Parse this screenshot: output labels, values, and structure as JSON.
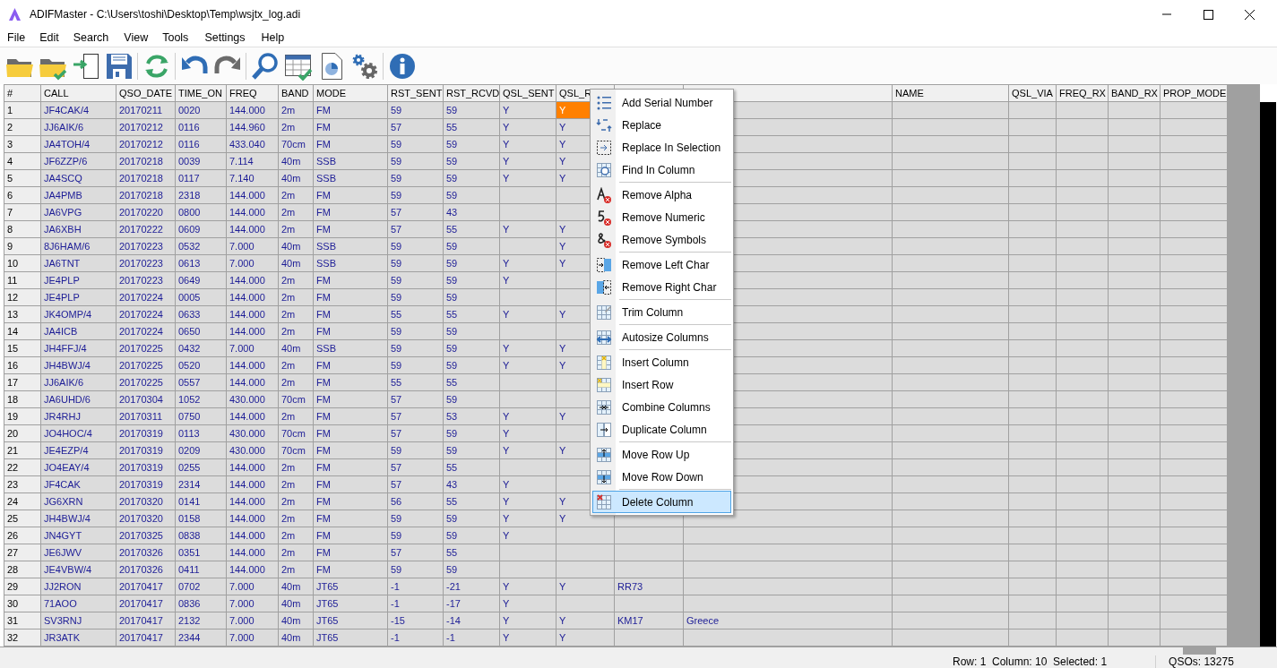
{
  "window": {
    "title": "ADIFMaster - C:\\Users\\toshi\\Desktop\\Temp\\wsjtx_log.adi"
  },
  "menu_bar": [
    "File",
    "Edit",
    "Search",
    "View",
    "Tools",
    "Settings",
    "Help"
  ],
  "table": {
    "columns": [
      {
        "label": "#",
        "selected": false
      },
      {
        "label": "CALL",
        "selected": false
      },
      {
        "label": "QSO_DATE",
        "selected": false
      },
      {
        "label": "TIME_ON",
        "selected": false
      },
      {
        "label": "FREQ",
        "selected": false
      },
      {
        "label": "BAND",
        "selected": false
      },
      {
        "label": "MODE",
        "selected": false
      },
      {
        "label": "RST_SENT",
        "selected": false
      },
      {
        "label": "RST_RCVD",
        "selected": false
      },
      {
        "label": "QSL_SENT",
        "selected": false
      },
      {
        "label": "QSL_R",
        "selected": true
      },
      {},
      {},
      {
        "label": "NAME",
        "selected": false
      },
      {
        "label": "QSL_VIA",
        "selected": false
      },
      {
        "label": "FREQ_RX",
        "selected": false
      },
      {
        "label": "BAND_RX",
        "selected": false
      },
      {
        "label": "PROP_MODE",
        "selected": false
      }
    ],
    "rows": [
      {
        "selected": true,
        "cells": [
          "1",
          "JF4CAK/4",
          "20170211",
          "0020",
          "144.000",
          "2m",
          "FM",
          "59",
          "59",
          "Y",
          "Y"
        ]
      },
      {
        "selected": false,
        "cells": [
          "2",
          "JJ6AIK/6",
          "20170212",
          "0116",
          "144.960",
          "2m",
          "FM",
          "57",
          "55",
          "Y",
          "Y"
        ]
      },
      {
        "selected": false,
        "cells": [
          "3",
          "JA4TOH/4",
          "20170212",
          "0116",
          "433.040",
          "70cm",
          "FM",
          "59",
          "59",
          "Y",
          "Y"
        ]
      },
      {
        "selected": false,
        "cells": [
          "4",
          "JF6ZZP/6",
          "20170218",
          "0039",
          "7.114",
          "40m",
          "SSB",
          "59",
          "59",
          "Y",
          "Y"
        ]
      },
      {
        "selected": false,
        "cells": [
          "5",
          "JA4SCQ",
          "20170218",
          "0117",
          "7.140",
          "40m",
          "SSB",
          "59",
          "59",
          "Y",
          "Y"
        ]
      },
      {
        "selected": false,
        "cells": [
          "6",
          "JA4PMB",
          "20170218",
          "2318",
          "144.000",
          "2m",
          "FM",
          "59",
          "59"
        ]
      },
      {
        "selected": false,
        "cells": [
          "7",
          "JA6VPG",
          "20170220",
          "0800",
          "144.000",
          "2m",
          "FM",
          "57",
          "43"
        ]
      },
      {
        "selected": false,
        "cells": [
          "8",
          "JA6XBH",
          "20170222",
          "0609",
          "144.000",
          "2m",
          "FM",
          "57",
          "55",
          "Y",
          "Y"
        ]
      },
      {
        "selected": false,
        "cells": [
          "9",
          "8J6HAM/6",
          "20170223",
          "0532",
          "7.000",
          "40m",
          "SSB",
          "59",
          "59",
          "",
          "Y"
        ]
      },
      {
        "selected": false,
        "cells": [
          "10",
          "JA6TNT",
          "20170223",
          "0613",
          "7.000",
          "40m",
          "SSB",
          "59",
          "59",
          "Y",
          "Y"
        ]
      },
      {
        "selected": false,
        "cells": [
          "11",
          "JE4PLP",
          "20170223",
          "0649",
          "144.000",
          "2m",
          "FM",
          "59",
          "59",
          "Y"
        ]
      },
      {
        "selected": false,
        "cells": [
          "12",
          "JE4PLP",
          "20170224",
          "0005",
          "144.000",
          "2m",
          "FM",
          "59",
          "59"
        ]
      },
      {
        "selected": false,
        "cells": [
          "13",
          "JK4OMP/4",
          "20170224",
          "0633",
          "144.000",
          "2m",
          "FM",
          "55",
          "55",
          "Y",
          "Y"
        ]
      },
      {
        "selected": false,
        "cells": [
          "14",
          "JA4ICB",
          "20170224",
          "0650",
          "144.000",
          "2m",
          "FM",
          "59",
          "59"
        ]
      },
      {
        "selected": false,
        "cells": [
          "15",
          "JH4FFJ/4",
          "20170225",
          "0432",
          "7.000",
          "40m",
          "SSB",
          "59",
          "59",
          "Y",
          "Y"
        ]
      },
      {
        "selected": false,
        "cells": [
          "16",
          "JH4BWJ/4",
          "20170225",
          "0520",
          "144.000",
          "2m",
          "FM",
          "59",
          "59",
          "Y",
          "Y"
        ]
      },
      {
        "selected": false,
        "cells": [
          "17",
          "JJ6AIK/6",
          "20170225",
          "0557",
          "144.000",
          "2m",
          "FM",
          "55",
          "55"
        ]
      },
      {
        "selected": false,
        "cells": [
          "18",
          "JA6UHD/6",
          "20170304",
          "1052",
          "430.000",
          "70cm",
          "FM",
          "57",
          "59"
        ]
      },
      {
        "selected": false,
        "cells": [
          "19",
          "JR4RHJ",
          "20170311",
          "0750",
          "144.000",
          "2m",
          "FM",
          "57",
          "53",
          "Y",
          "Y"
        ]
      },
      {
        "selected": false,
        "cells": [
          "20",
          "JO4HOC/4",
          "20170319",
          "0113",
          "430.000",
          "70cm",
          "FM",
          "57",
          "59",
          "Y"
        ]
      },
      {
        "selected": false,
        "cells": [
          "21",
          "JE4EZP/4",
          "20170319",
          "0209",
          "430.000",
          "70cm",
          "FM",
          "59",
          "59",
          "Y",
          "Y"
        ]
      },
      {
        "selected": false,
        "cells": [
          "22",
          "JO4EAY/4",
          "20170319",
          "0255",
          "144.000",
          "2m",
          "FM",
          "57",
          "55"
        ]
      },
      {
        "selected": false,
        "cells": [
          "23",
          "JF4CAK",
          "20170319",
          "2314",
          "144.000",
          "2m",
          "FM",
          "57",
          "43",
          "Y"
        ]
      },
      {
        "selected": false,
        "cells": [
          "24",
          "JG6XRN",
          "20170320",
          "0141",
          "144.000",
          "2m",
          "FM",
          "56",
          "55",
          "Y",
          "Y"
        ]
      },
      {
        "selected": false,
        "cells": [
          "25",
          "JH4BWJ/4",
          "20170320",
          "0158",
          "144.000",
          "2m",
          "FM",
          "59",
          "59",
          "Y",
          "Y"
        ]
      },
      {
        "selected": false,
        "cells": [
          "26",
          "JN4GYT",
          "20170325",
          "0838",
          "144.000",
          "2m",
          "FM",
          "59",
          "59",
          "Y"
        ]
      },
      {
        "selected": false,
        "cells": [
          "27",
          "JE6JWV",
          "20170326",
          "0351",
          "144.000",
          "2m",
          "FM",
          "57",
          "55"
        ]
      },
      {
        "selected": false,
        "cells": [
          "28",
          "JE4VBW/4",
          "20170326",
          "0411",
          "144.000",
          "2m",
          "FM",
          "59",
          "59"
        ]
      },
      {
        "selected": false,
        "cells": [
          "29",
          "JJ2RON",
          "20170417",
          "0702",
          "7.000",
          "40m",
          "JT65",
          "-1",
          "-21",
          "Y",
          "Y",
          "RR73"
        ]
      },
      {
        "selected": false,
        "cells": [
          "30",
          "71AOO",
          "20170417",
          "0836",
          "7.000",
          "40m",
          "JT65",
          "-1",
          "-17",
          "Y"
        ]
      },
      {
        "selected": false,
        "cells": [
          "31",
          "SV3RNJ",
          "20170417",
          "2132",
          "7.000",
          "40m",
          "JT65",
          "-15",
          "-14",
          "Y",
          "Y",
          "KM17",
          "Greece"
        ]
      },
      {
        "selected": false,
        "cells": [
          "32",
          "JR3ATK",
          "20170417",
          "2344",
          "7.000",
          "40m",
          "JT65",
          "-1",
          "-1",
          "Y",
          "Y"
        ]
      }
    ]
  },
  "context_menu": {
    "groups": [
      {
        "items": [
          {
            "label": "Add Serial Number",
            "selected": false
          },
          {
            "label": "Replace",
            "selected": false
          },
          {
            "label": "Replace In Selection",
            "selected": false
          },
          {
            "label": "Find In Column",
            "selected": false
          }
        ]
      },
      {
        "items": [
          {
            "label": "Remove Alpha",
            "selected": false
          },
          {
            "label": "Remove Numeric",
            "selected": false
          },
          {
            "label": "Remove Symbols",
            "selected": false
          }
        ]
      },
      {
        "items": [
          {
            "label": "Remove Left Char",
            "selected": false
          },
          {
            "label": "Remove Right Char",
            "selected": false
          }
        ]
      },
      {
        "items": [
          {
            "label": "Trim Column",
            "selected": false
          }
        ]
      },
      {
        "items": [
          {
            "label": "Autosize Columns",
            "selected": false
          }
        ]
      },
      {
        "items": [
          {
            "label": "Insert Column",
            "selected": false
          },
          {
            "label": "Insert Row",
            "selected": false
          },
          {
            "label": "Combine Columns",
            "selected": false
          },
          {
            "label": "Duplicate Column",
            "selected": false
          }
        ]
      },
      {
        "items": [
          {
            "label": "Move Row Up",
            "selected": false
          },
          {
            "label": "Move Row Down",
            "selected": false
          }
        ]
      },
      {
        "items": [
          {
            "label": "Delete Column",
            "selected": true
          }
        ]
      }
    ]
  },
  "status_bar": {
    "position": "Row: 1  Column: 10  Selected: 1",
    "count": "QSOs: 13275"
  }
}
